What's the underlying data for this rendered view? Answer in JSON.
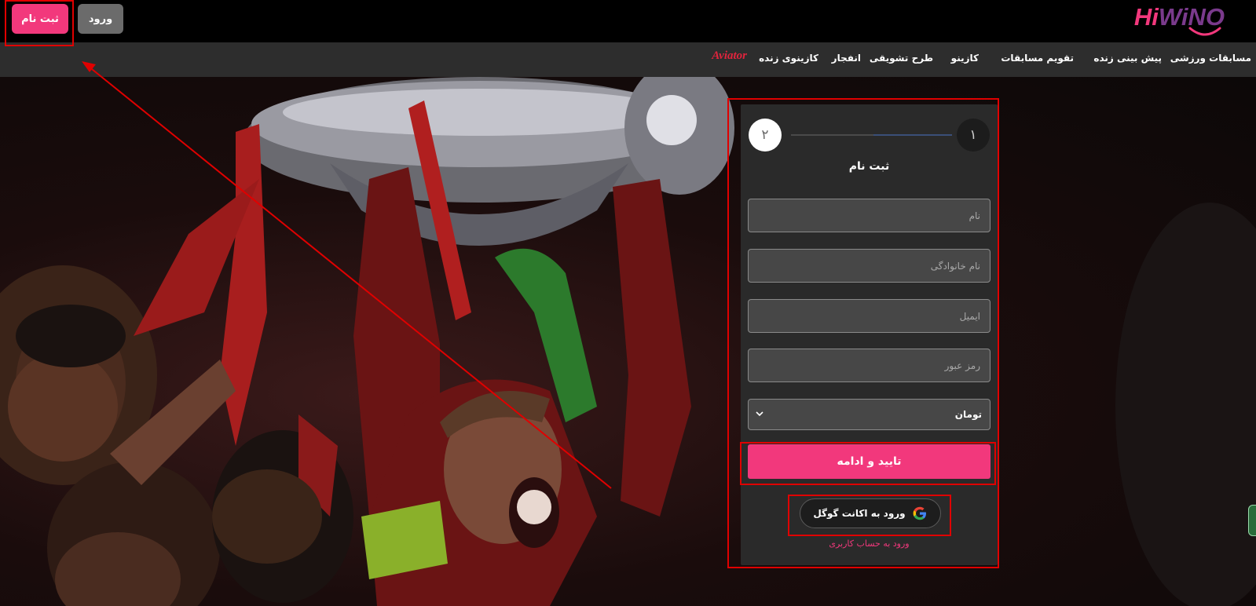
{
  "header": {
    "register_label": "ثبت نام",
    "login_label": "ورود",
    "logo": {
      "hi": "Hi",
      "rest": "WiNO"
    }
  },
  "nav": {
    "items": [
      "مسابقات ورزشی",
      "پیش بینی زنده",
      "تقویم مسابقات",
      "کازینو",
      "طرح تشویقی",
      "انفجار",
      "کازینوی زنده"
    ],
    "aviator": "Aviator"
  },
  "form": {
    "step_1": "۱",
    "step_2": "۲",
    "title": "ثبت نام",
    "first_name_placeholder": "نام",
    "last_name_placeholder": "نام خانوادگی",
    "email_placeholder": "ایمیل",
    "password_placeholder": "رمز عبور",
    "currency_value": "تومان",
    "submit_label": "تایید و ادامه",
    "google_label": "ورود به اکانت گوگل",
    "login_link": "ورود به حساب کاربری"
  },
  "colors": {
    "accent": "#f2387c",
    "annotation": "#e00000",
    "panel": "#2a2a2a",
    "nav_bg": "#2d2d2d"
  }
}
